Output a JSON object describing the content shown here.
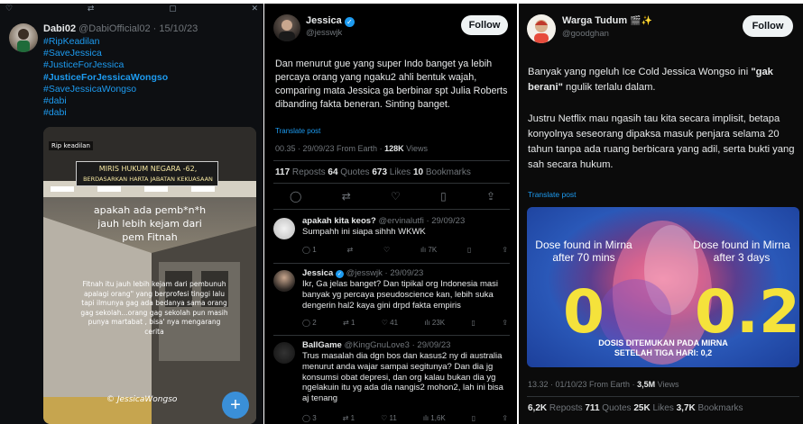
{
  "panel1": {
    "top_icons": [
      "heart-icon",
      "repost-icon",
      "bookmark-icon",
      "close-icon"
    ],
    "author": {
      "name": "Dabi02",
      "handle": "@DabiOfficial02",
      "date": "15/10/23"
    },
    "hashtags": [
      "#RipKeadilan",
      "#SaveJessica",
      "#JusticeForJessica",
      "#JusticeForJessicaWongso",
      "#SaveJessicaWongso",
      "#dabi",
      "#dabi"
    ],
    "bold_hashtag_index": 3,
    "media": {
      "tag": "Rip keadilan",
      "banner_line1": "MIRIS HUKUM NEGARA -62,",
      "banner_line2": "BERDASARKAN HARTA JABATAN KEKUASAAN",
      "quote_line1": "apakah ada pemb*n*h",
      "quote_line2": "jauh lebih kejam dari",
      "quote_line3": "pem Fitnah",
      "caption": "Fitnah itu jauh lebih kejam dari pembunuh apalagi orang\" yang berprofesi tinggi lalu tapi ilmunya gag ada bedanya sama orang gag sekolah...orang gag sekolah pun masih punya martabat , bisa' nya mengarang cerita",
      "signature": "© JessicaWongso",
      "fab_label": "+"
    }
  },
  "panel2": {
    "author": {
      "name": "Jessica",
      "handle": "@jesswjk",
      "follow_label": "Follow"
    },
    "text": "Dan menurut gue yang super Indo banget ya lebih percaya orang yang ngaku2 ahli bentuk wajah, comparing mata Jessica ga berbinar spt Julia Roberts dibanding fakta beneran. Sinting banget.",
    "translate": "Translate post",
    "meta": {
      "time": "00.35 · 29/09/23 From Earth ·",
      "views": "128K",
      "views_label": "Views"
    },
    "stats": [
      {
        "value": "117",
        "label": "Reposts"
      },
      {
        "value": "64",
        "label": "Quotes"
      },
      {
        "value": "673",
        "label": "Likes"
      },
      {
        "value": "10",
        "label": "Bookmarks"
      }
    ],
    "actions": [
      "reply-icon",
      "repost-icon",
      "like-icon",
      "bookmark-icon",
      "share-icon"
    ],
    "replies": [
      {
        "name": "apakah kita keos?",
        "handle": "@ervinalutfi · 29/09/23",
        "text": "Sumpahh ini siapa sihhh WKWK",
        "counts": {
          "reply": "1",
          "repost": "",
          "like": "",
          "views": "7K"
        }
      },
      {
        "name": "Jessica",
        "handle": "@jesswjk · 29/09/23",
        "text": "Ikr, Ga jelas banget? Dan tipikal org Indonesia masi banyak yg percaya pseudoscience kan, lebih suka dengerin hal2 kaya gini drpd fakta empiris",
        "counts": {
          "reply": "2",
          "repost": "1",
          "like": "41",
          "views": "23K"
        }
      },
      {
        "name": "BallGame",
        "handle": "@KingGnuLove3 · 29/09/23",
        "text": "Trus masalah dia dgn bos dan kasus2 ny di australia menurut anda wajar sampai segitunya? Dan dia jg konsumsi obat depresi, dan org kalau bukan dia yg ngelakuin itu yg ada dia nangis2 mohon2, lah ini bisa aj tenang",
        "counts": {
          "reply": "3",
          "repost": "1",
          "like": "11",
          "views": "1,6K"
        }
      }
    ]
  },
  "panel3": {
    "author": {
      "name": "Warga Tudum",
      "emoji": "🎬✨",
      "handle": "@goodghan",
      "follow_label": "Follow"
    },
    "para1_pre": "Banyak yang ngeluh Ice Cold Jessica Wongso ini ",
    "para1_bold": "\"gak berani\"",
    "para1_post": " ngulik terlalu dalam.",
    "para2": "Justru Netflix mau ngasih tau kita secara implisit, betapa konyolnya seseorang dipaksa masuk penjara selama 20 tahun tanpa ada ruang berbicara yang adil, serta bukti yang sah secara hukum.",
    "translate": "Translate post",
    "media": {
      "left_label_1": "Dose found in Mirna",
      "left_label_2": "after 70 mins",
      "left_value": "0",
      "right_label_1": "Dose found in Mirna",
      "right_label_2": "after 3 days",
      "right_value": "0.2",
      "caption_1": "DOSIS DITEMUKAN PADA MIRNA",
      "caption_2": "SETELAH TIGA HARI: 0,2"
    },
    "meta": {
      "time": "13.32 · 01/10/23 From Earth ·",
      "views": "3,5M",
      "views_label": "Views"
    },
    "stats": [
      {
        "value": "6,2K",
        "label": "Reposts"
      },
      {
        "value": "711",
        "label": "Quotes"
      },
      {
        "value": "25K",
        "label": "Likes"
      },
      {
        "value": "3,7K",
        "label": "Bookmarks"
      }
    ]
  }
}
